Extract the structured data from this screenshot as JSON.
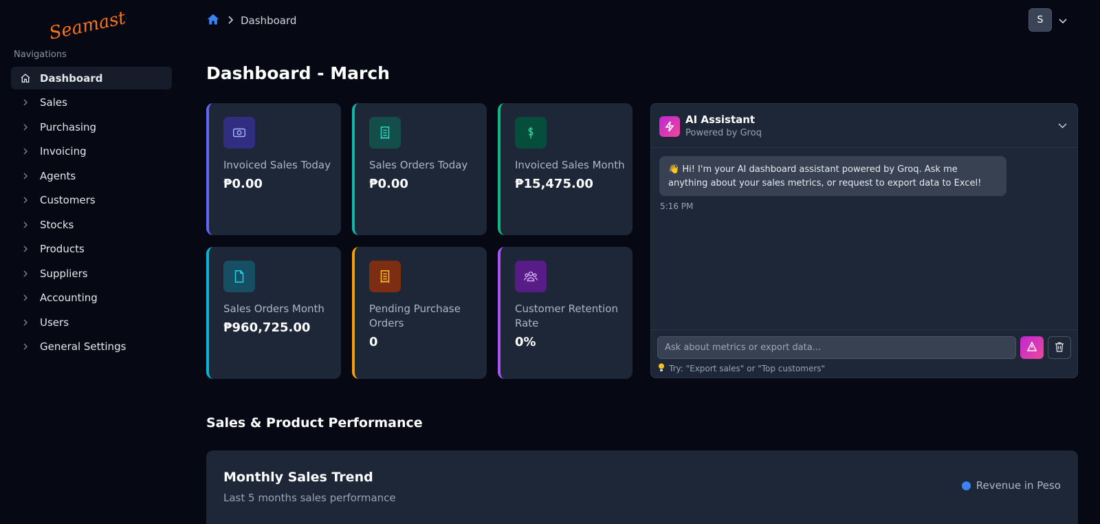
{
  "brand": {
    "logo_text": "Seamaster",
    "accent": "#f97316"
  },
  "sidebar": {
    "heading": "Navigations",
    "items": [
      {
        "label": "Dashboard",
        "icon": "home-icon",
        "active": true
      },
      {
        "label": "Sales",
        "icon": "chevron-right-icon"
      },
      {
        "label": "Purchasing",
        "icon": "chevron-right-icon"
      },
      {
        "label": "Invoicing",
        "icon": "chevron-right-icon"
      },
      {
        "label": "Agents",
        "icon": "chevron-right-icon"
      },
      {
        "label": "Customers",
        "icon": "chevron-right-icon"
      },
      {
        "label": "Stocks",
        "icon": "chevron-right-icon"
      },
      {
        "label": "Products",
        "icon": "chevron-right-icon"
      },
      {
        "label": "Suppliers",
        "icon": "chevron-right-icon"
      },
      {
        "label": "Accounting",
        "icon": "chevron-right-icon"
      },
      {
        "label": "Users",
        "icon": "chevron-right-icon"
      },
      {
        "label": "General Settings",
        "icon": "chevron-right-icon"
      }
    ]
  },
  "header": {
    "breadcrumb": {
      "current": "Dashboard"
    },
    "user": {
      "initial": "S"
    }
  },
  "page": {
    "title": "Dashboard - March"
  },
  "cards": [
    {
      "label": "Invoiced Sales Today",
      "value": "₱0.00",
      "icon": "money-icon",
      "accent": "#6366f1",
      "icon_bg": "#312e81",
      "icon_color": "#a5b4fc"
    },
    {
      "label": "Sales Orders Today",
      "value": "₱0.00",
      "icon": "receipt-icon",
      "accent": "#14b8a6",
      "icon_bg": "#134e4a",
      "icon_color": "#2dd4bf"
    },
    {
      "label": "Invoiced Sales Month",
      "value": "₱15,475.00",
      "icon": "dollar-icon",
      "accent": "#10b981",
      "icon_bg": "#064e3b",
      "icon_color": "#34d399"
    },
    {
      "label": "Sales Orders Month",
      "value": "₱960,725.00",
      "icon": "document-icon",
      "accent": "#06b6d4",
      "icon_bg": "#164e63",
      "icon_color": "#22d3ee"
    },
    {
      "label": "Pending Purchase Orders",
      "value": "0",
      "icon": "receipt-icon",
      "accent": "#f59e0b",
      "icon_bg": "#7c2d12",
      "icon_color": "#fbbf24"
    },
    {
      "label": "Customer Retention Rate",
      "value": "0%",
      "icon": "users-icon",
      "accent": "#a855f7",
      "icon_bg": "#581c87",
      "icon_color": "#d8b4fe"
    }
  ],
  "ai": {
    "title": "AI Assistant",
    "subtitle": "Powered by Groq",
    "message": "👋 Hi! I'm your AI dashboard assistant powered by Groq. Ask me anything about your sales metrics, or request to export data to Excel!",
    "time": "5:16 PM",
    "input_placeholder": "Ask about metrics or export data...",
    "tip": "Try: \"Export sales\" or \"Top customers\""
  },
  "section": {
    "title": "Sales & Product Performance"
  },
  "chart": {
    "title": "Monthly Sales Trend",
    "subtitle": "Last 5 months sales performance",
    "legend": "Revenue in Peso",
    "legend_color": "#3b82f6"
  }
}
